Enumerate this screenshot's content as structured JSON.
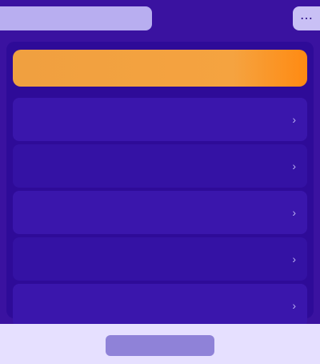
{
  "colors": {
    "background": "#3a12a0",
    "panel": "#2e0b98",
    "accent_orange": "#f5a340",
    "tab_pill": "#b8aef0",
    "bottom_bar": "#e6e0ff",
    "bottom_button": "#8f82d8"
  },
  "top": {
    "tab_label": "",
    "corner_icon": "more-icon"
  },
  "header": {
    "title": ""
  },
  "rows": [
    {
      "text": ""
    },
    {
      "text": ""
    },
    {
      "text": ""
    },
    {
      "text": ""
    },
    {
      "text": ""
    }
  ],
  "bottom": {
    "button_label": ""
  }
}
